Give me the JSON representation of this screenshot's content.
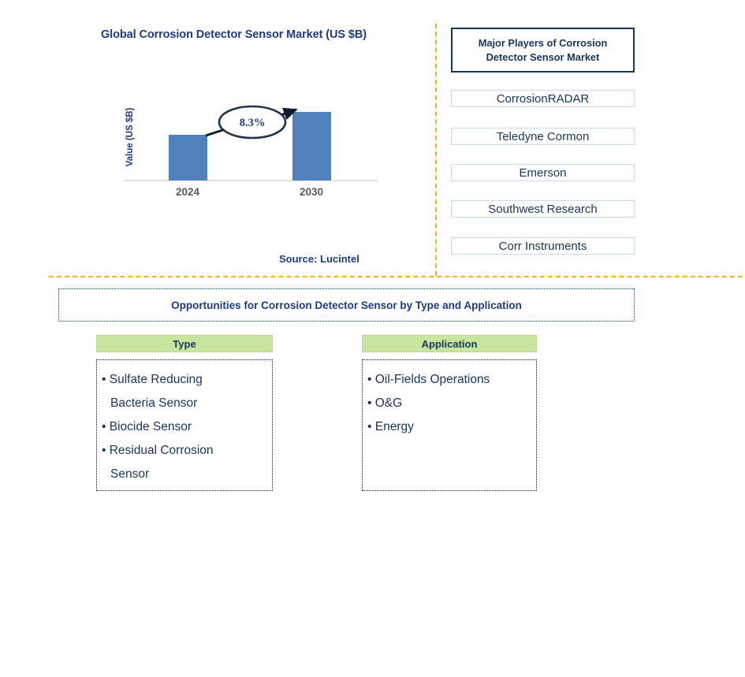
{
  "chart_title": "Global Corrosion Detector Sensor Market (US $B)",
  "source_note": "Source: Lucintel",
  "chart_data": {
    "type": "bar",
    "title": "Global Corrosion Detector Sensor Market (US $B)",
    "categories": [
      "2024",
      "2030"
    ],
    "values": [
      1.0,
      1.6
    ],
    "xlabel": "",
    "ylabel": "Value (US $B)",
    "ylim": [
      0,
      1.85
    ],
    "grid": false,
    "legend": "none",
    "bar_color": "#4f81bd",
    "annotation": {
      "label": "8.3%",
      "kind": "cagr-callout-ellipse",
      "from_category": "2024",
      "to_category": "2030"
    },
    "tick_label_color": "#595959"
  },
  "players_panel": {
    "header": "Major Players of Corrosion Detector Sensor Market",
    "header_line_1": "Major Players of Corrosion",
    "header_line_2": "Detector Sensor Market",
    "items": [
      "CorrosionRADAR",
      "Teledyne Cormon",
      "Emerson",
      "Southwest Research",
      "Corr Instruments"
    ]
  },
  "opportunities": {
    "banner": "Opportunities for Corrosion Detector Sensor by Type and Application",
    "columns": [
      {
        "header": "Type",
        "items": [
          {
            "lines": [
              "Sulfate Reducing",
              "Bacteria Sensor"
            ]
          },
          {
            "lines": [
              "Biocide Sensor"
            ]
          },
          {
            "lines": [
              "Residual Corrosion",
              "Sensor"
            ]
          }
        ]
      },
      {
        "header": "Application",
        "items": [
          {
            "lines": [
              "Oil-Fields Operations"
            ]
          },
          {
            "lines": [
              "O&G"
            ]
          },
          {
            "lines": [
              "Energy"
            ]
          }
        ]
      }
    ]
  },
  "colors": {
    "navy": "#17365d",
    "title_blue": "#1f3b87",
    "bar_blue": "#4f81bd",
    "divider_orange": "#f5b31b",
    "header_green": "#c9e5a0",
    "item_border_blue": "#c6dbf0"
  }
}
